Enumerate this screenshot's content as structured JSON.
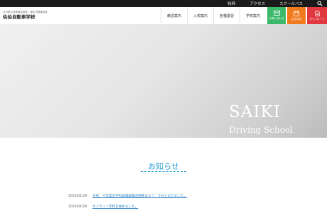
{
  "topbar": {
    "links": [
      "特典",
      "アクセス",
      "スクールバス"
    ],
    "search_icon": "search-icon"
  },
  "header": {
    "logo_sub": "大分県公安委員会指定・厚生労働省指定",
    "logo_main": "佐伯自動車学校",
    "nav": [
      "教習案内",
      "入校案内",
      "各種講習",
      "学校案内"
    ],
    "quick_links": [
      {
        "label": "お問い合わせ",
        "icon": "mail-icon",
        "color": "#3cb86a"
      },
      {
        "label": "空き状況",
        "icon": "calendar-icon",
        "color": "#f07a1e"
      },
      {
        "label": "ダウンロード",
        "icon": "document-icon",
        "color": "#e0383e"
      }
    ]
  },
  "hero": {
    "title": "SAIKI",
    "subtitle": "Driving School"
  },
  "news": {
    "heading": "お知らせ",
    "items": [
      {
        "date": "2023/01/29",
        "text": "令和　４年度の学科試験試験合格率は９７．５％となりました。"
      },
      {
        "date": "2023/01/29",
        "text": "オンライン学科を始めました。"
      }
    ]
  }
}
